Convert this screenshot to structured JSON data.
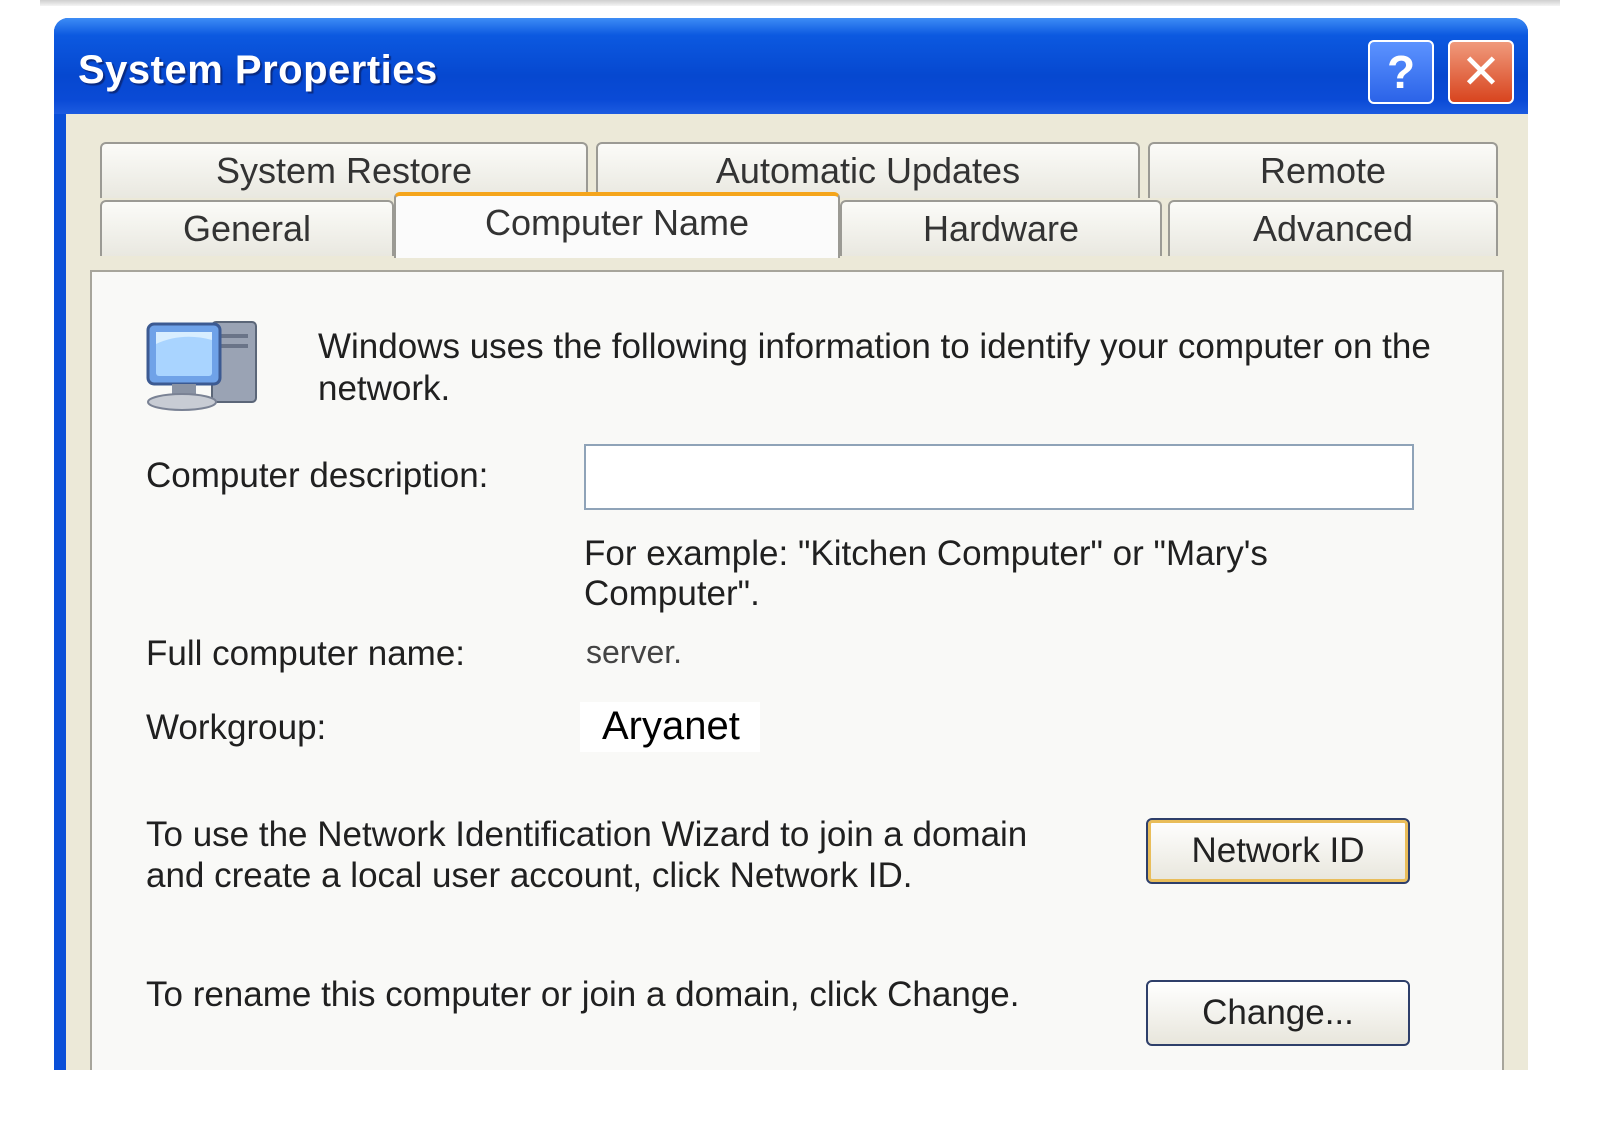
{
  "window": {
    "title": "System Properties",
    "help_label": "?",
    "close_label": "✕"
  },
  "tabs": {
    "row1": [
      "System Restore",
      "Automatic Updates",
      "Remote"
    ],
    "row2": [
      "General",
      "Computer Name",
      "Hardware",
      "Advanced"
    ],
    "active": "Computer Name"
  },
  "panel": {
    "intro": "Windows uses the following information to identify your computer on the network.",
    "description_label": "Computer description:",
    "description_value": "",
    "example": "For example: \"Kitchen Computer\" or \"Mary's Computer\".",
    "full_name_label": "Full computer name:",
    "full_name_value": "server.",
    "workgroup_label": "Workgroup:",
    "workgroup_value": "Aryanet",
    "network_id_text": "To use the Network Identification Wizard to join a domain and create a local user account, click Network ID.",
    "network_id_button": "Network ID",
    "rename_text": "To rename this computer or join a domain, click Change.",
    "change_button": "Change..."
  },
  "icons": {
    "computer": "computer-icon",
    "help": "help-icon",
    "close": "close-icon"
  },
  "colors": {
    "titlebar": "#0648d0",
    "active_tab_accent": "#f5a51c",
    "dialog_background": "#ece9d8"
  }
}
